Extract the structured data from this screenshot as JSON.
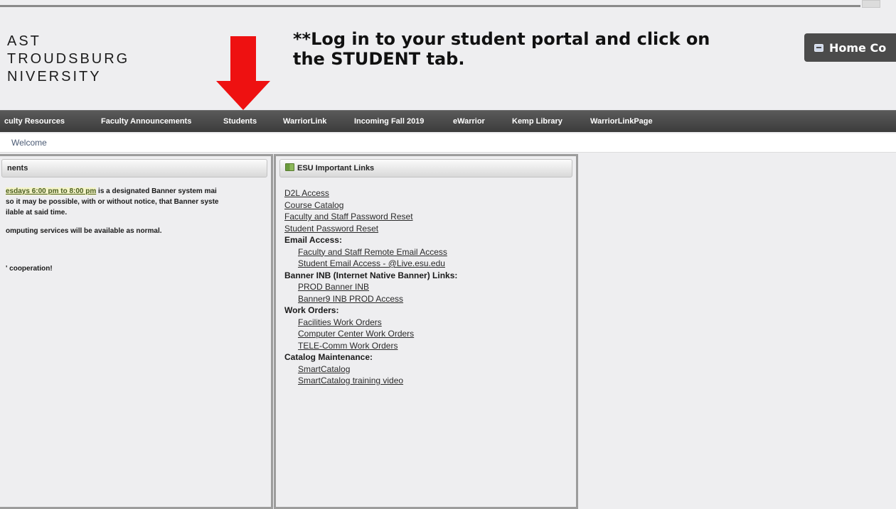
{
  "logo": {
    "lines": [
      "AST",
      "TROUDSBURG",
      "NIVERSITY"
    ]
  },
  "notice": {
    "line1": "**Log in to your student portal and click on",
    "line2": "the STUDENT tab."
  },
  "header_button": {
    "label": "Home Co",
    "icon": "home-icon"
  },
  "nav": {
    "items": [
      "culty Resources",
      "Faculty Announcements",
      "Students",
      "WarriorLink",
      "Incoming Fall 2019",
      "eWarrior",
      "Kemp Library",
      "WarriorLinkPage"
    ]
  },
  "breadcrumb": {
    "label": "Welcome"
  },
  "announcements": {
    "title": "nents",
    "highlight": "esdays 6:00 pm to 8:00 pm",
    "line1_rest": " is a designated Banner system mai",
    "line2": "so it may be possible, with or without notice, that Banner syste",
    "line3": "ilable at said time.",
    "line4": "omputing services will be available as normal.",
    "line5": "' cooperation!"
  },
  "important_links": {
    "title": "ESU Important Links",
    "icon": "links-widget-icon",
    "items": {
      "d2l": "D2L Access",
      "catalog": "Course Catalog",
      "faculty_pw": "Faculty and Staff Password Reset",
      "student_pw": "Student Password Reset",
      "email_hdr": "Email Access:",
      "faculty_email": "Faculty and Staff Remote Email Access",
      "student_email": "Student Email Access - @Live.esu.edu",
      "banner_hdr": "Banner INB (Internet Native Banner) Links:",
      "prod_banner": "PROD Banner INB",
      "banner9": "Banner9 INB PROD Access",
      "work_hdr": "Work Orders:",
      "facilities": "Facilities Work Orders",
      "computer_center": "Computer Center Work Orders",
      "telecomm": "TELE-Comm Work Orders",
      "catalog_hdr": "Catalog Maintenance:",
      "smartcatalog": "SmartCatalog",
      "smartcatalog_video": "SmartCatalog training video"
    }
  },
  "colors": {
    "arrow": "#ee1111",
    "navbar": "#444444",
    "page_bg": "#eeeef0"
  }
}
